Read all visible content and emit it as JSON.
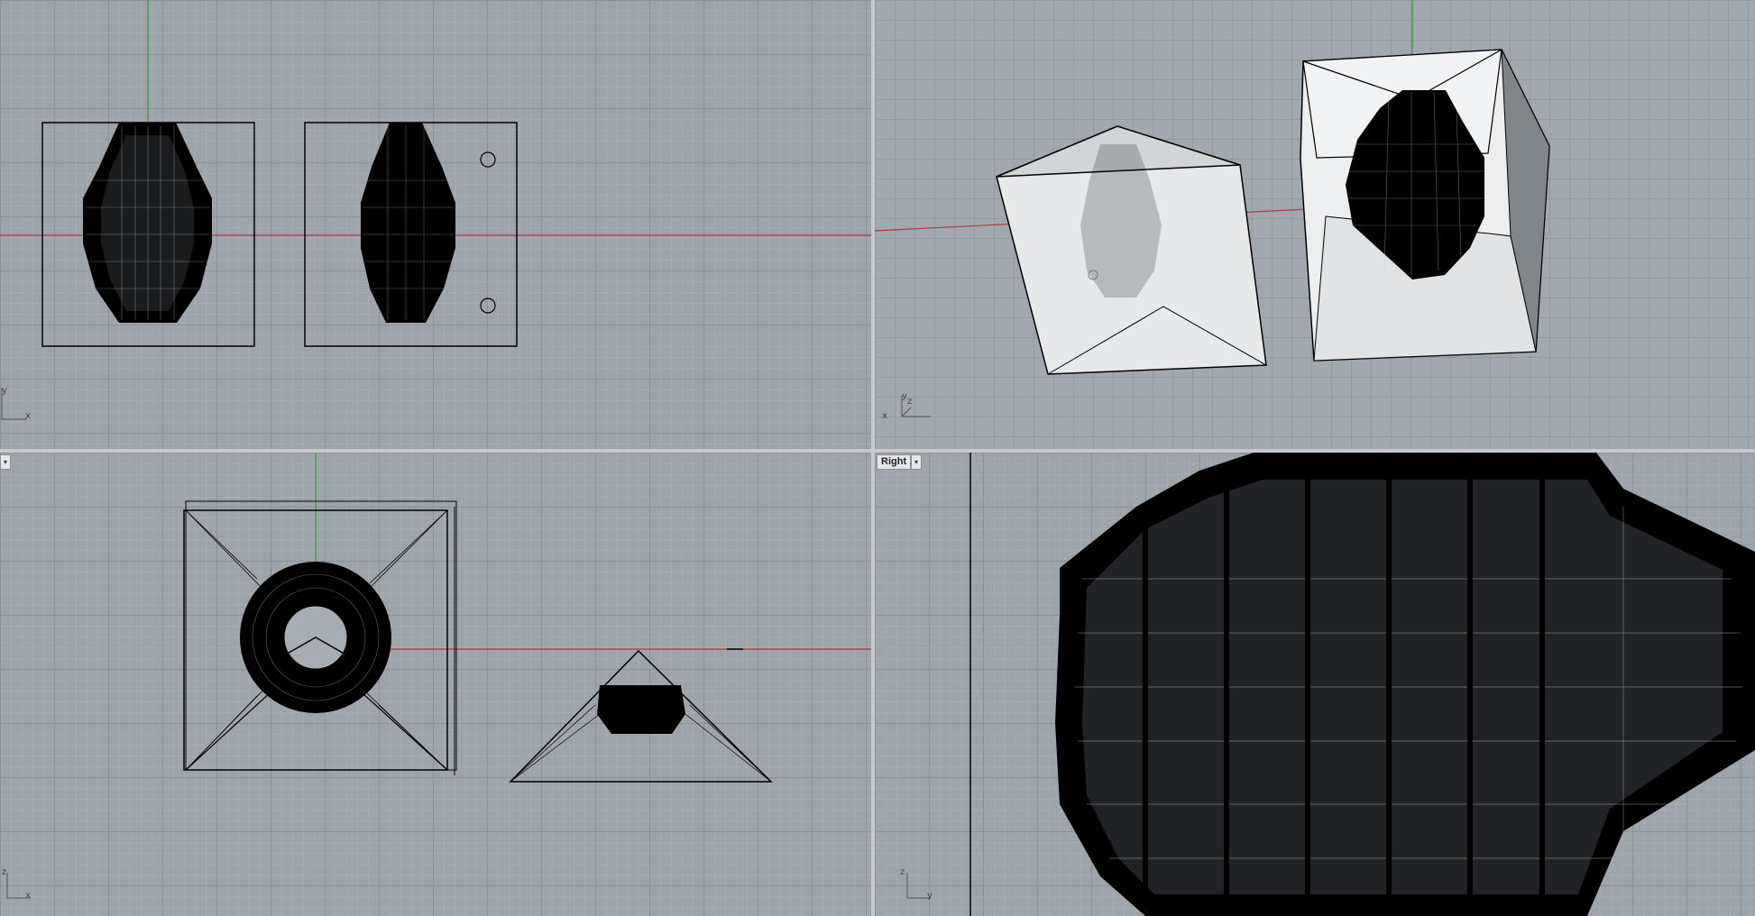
{
  "viewports": {
    "top": {
      "label": ""
    },
    "perspective": {
      "label": ""
    },
    "front": {
      "label": ""
    },
    "right": {
      "label": "Right"
    }
  },
  "axis_letters": {
    "top": [
      "y",
      "x"
    ],
    "perspective": [
      "z",
      "y",
      "x"
    ],
    "front": [
      "z",
      "x"
    ],
    "right": [
      "z",
      "y"
    ]
  },
  "dropdown_glyph": "▾",
  "colors": {
    "viewport_bg": "#9ea4ac",
    "x_axis": "#b03a3a",
    "y_axis": "#2f9a3a",
    "wire": "#000000",
    "box_face": "#e2e4e6"
  }
}
